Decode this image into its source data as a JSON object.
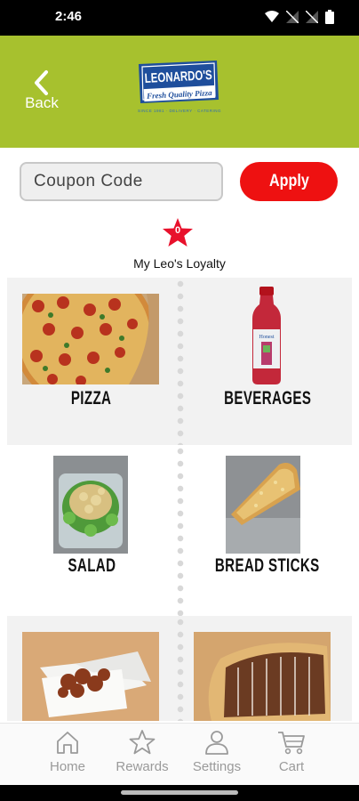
{
  "status_bar": {
    "time": "2:46"
  },
  "header": {
    "back_label": "Back",
    "logo": {
      "name": "LEONARDO'S",
      "tagline": "Fresh Quality Pizza",
      "subline": "SINCE 1981 · DELIVERY · CATERING"
    }
  },
  "coupon": {
    "placeholder": "Coupon Code",
    "value": "",
    "apply_label": "Apply"
  },
  "loyalty": {
    "points": "0",
    "label": "My Leo's Loyalty"
  },
  "categories": [
    {
      "label": "PIZZA",
      "image": "pizza-photo"
    },
    {
      "label": "BEVERAGES",
      "image": "bottled-drink-photo"
    },
    {
      "label": "SALAD",
      "image": "salad-photo"
    },
    {
      "label": "BREAD STICKS",
      "image": "breadstick-photo"
    },
    {
      "label": "",
      "image": "wings-photo"
    },
    {
      "label": "",
      "image": "dessert-bread-photo"
    }
  ],
  "bottom_nav": {
    "items": [
      {
        "label": "Home",
        "icon": "home-icon"
      },
      {
        "label": "Rewards",
        "icon": "star-icon"
      },
      {
        "label": "Settings",
        "icon": "user-icon"
      },
      {
        "label": "Cart",
        "icon": "cart-icon"
      }
    ]
  },
  "colors": {
    "header": "#a7c12e",
    "accent_red": "#ee1111",
    "logo_blue": "#1e4e9c"
  }
}
